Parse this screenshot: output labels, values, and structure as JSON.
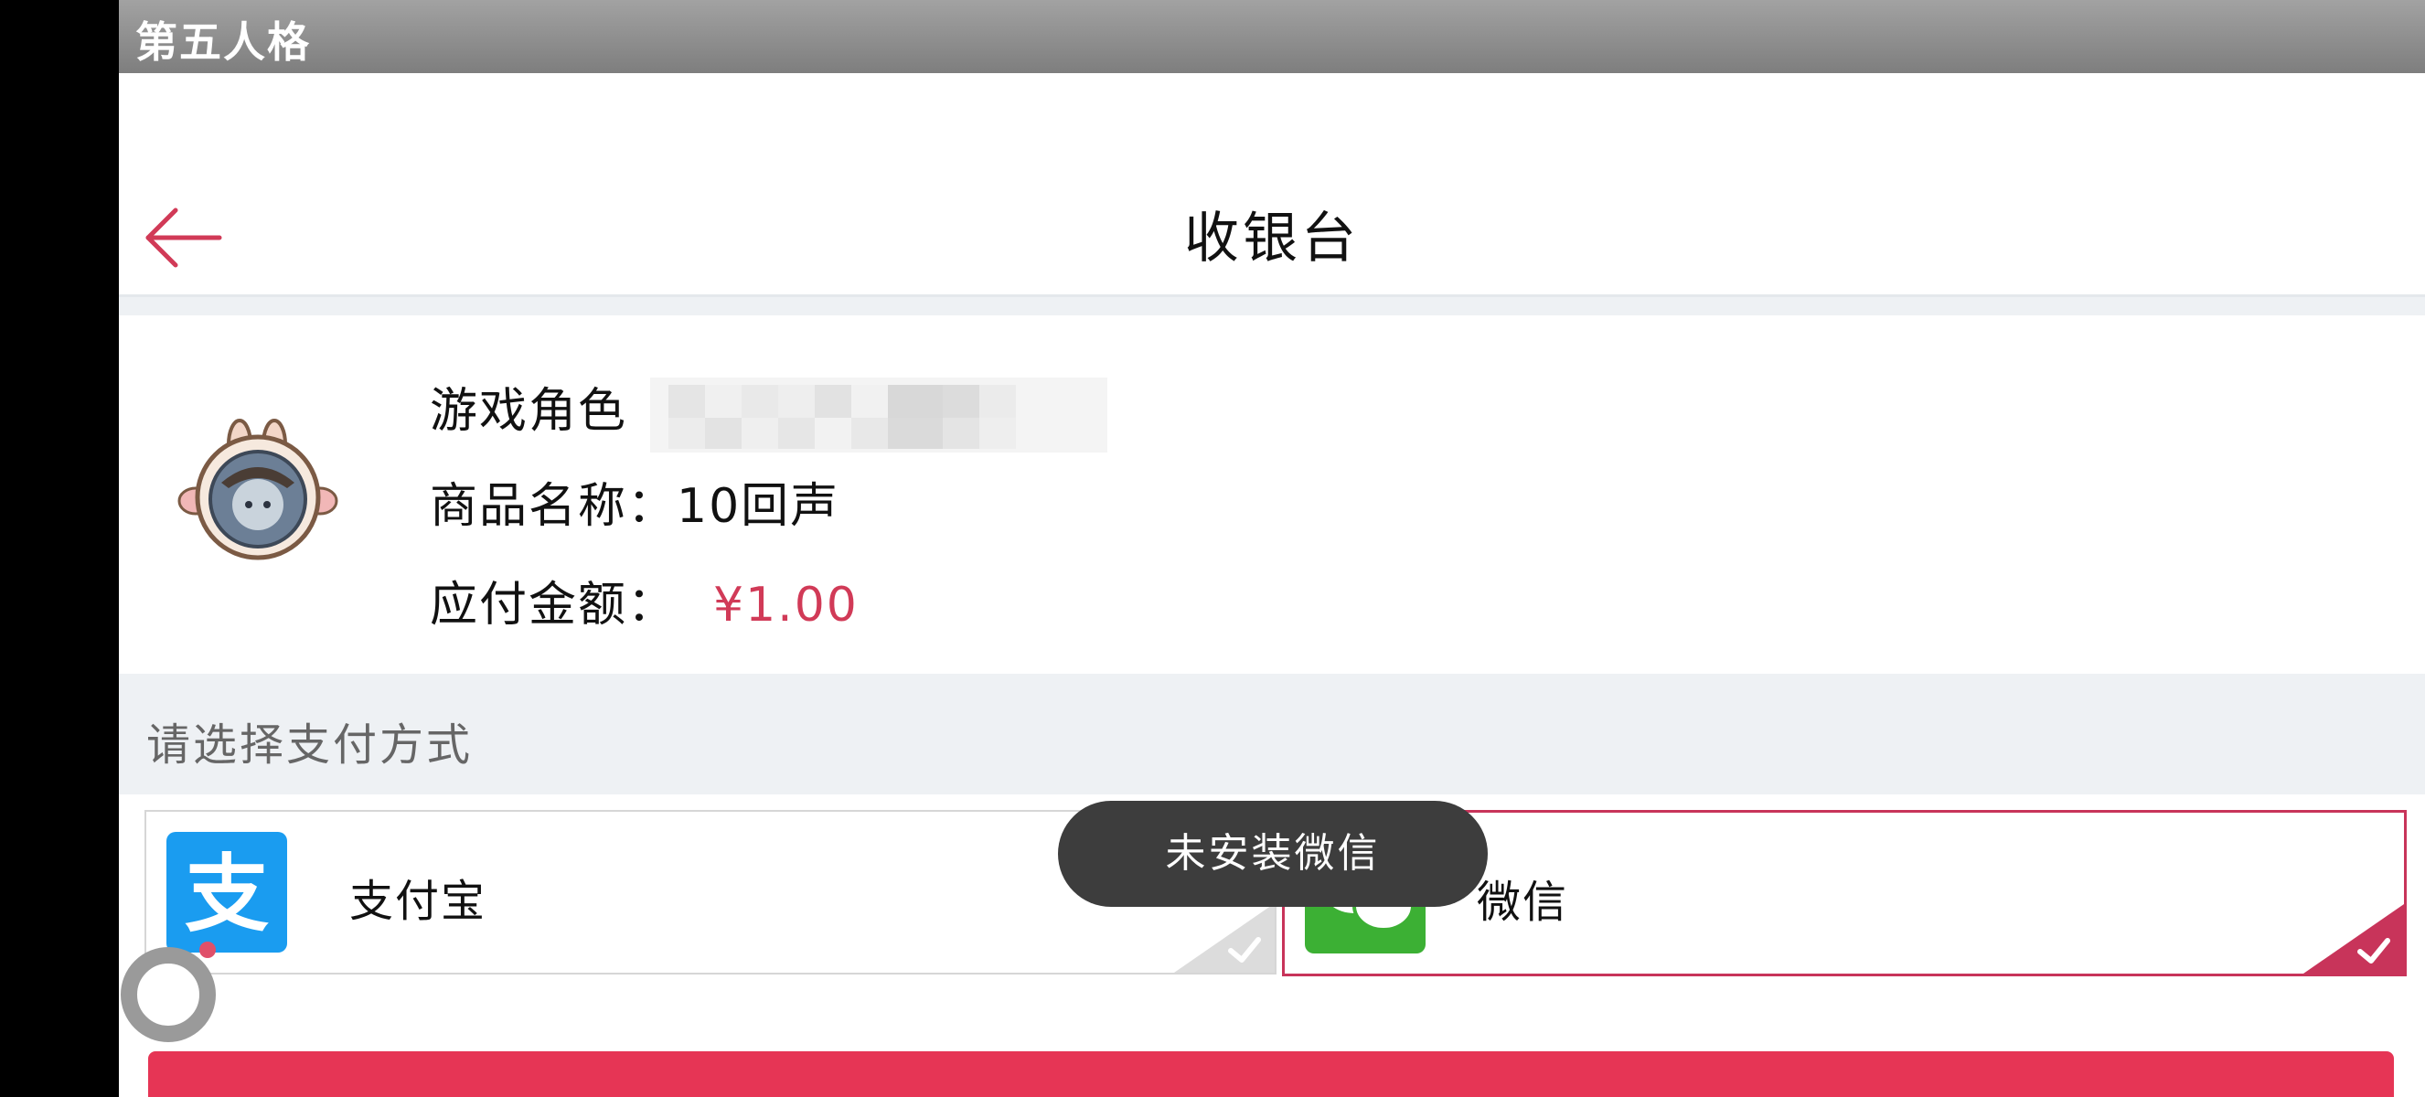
{
  "status_bar": {
    "app_name": "第五人格"
  },
  "navbar": {
    "title": "收银台",
    "back_icon": "arrow-left-icon"
  },
  "order": {
    "role_label": "游戏角色",
    "product_label": "商品名称：",
    "product_name": "10回声",
    "amount_label": "应付金额：",
    "amount": "¥1.00"
  },
  "payment": {
    "section_label": "请选择支付方式",
    "methods": [
      {
        "label": "支付宝",
        "icon": "alipay-icon",
        "selected": false
      },
      {
        "label": "微信",
        "icon": "wechat-icon",
        "selected": true
      }
    ]
  },
  "toast": {
    "message": "未安装微信"
  },
  "colors": {
    "accent": "#e63555",
    "price": "#d13a57",
    "alipay": "#1a9cf0",
    "wechat": "#3cb034"
  }
}
